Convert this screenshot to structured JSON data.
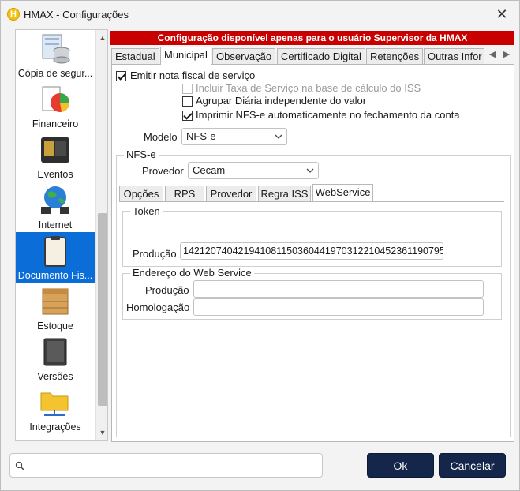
{
  "window": {
    "title": "HMAX - Configurações",
    "app_icon_letter": "H"
  },
  "sidebar": {
    "items": [
      {
        "label": "Cópia de segur...",
        "icon": "database-backup-icon"
      },
      {
        "label": "Financeiro",
        "icon": "finance-pie-icon"
      },
      {
        "label": "Eventos",
        "icon": "wallet-icon"
      },
      {
        "label": "Internet",
        "icon": "globe-network-icon"
      },
      {
        "label": "Documento Fis...",
        "icon": "clipboard-icon",
        "selected": true
      },
      {
        "label": "Estoque",
        "icon": "crate-icon"
      },
      {
        "label": "Versões",
        "icon": "tablet-icon"
      },
      {
        "label": "Integrações",
        "icon": "folder-network-icon"
      }
    ]
  },
  "banner": {
    "text": "Configuração disponível apenas para o usuário Supervisor da HMAX"
  },
  "tabs": [
    "Estadual",
    "Municipal",
    "Observação",
    "Certificado Digital",
    "Retenções",
    "Outras Infor"
  ],
  "active_tab": "Municipal",
  "municipal": {
    "emitir_label": "Emitir nota fiscal de serviço",
    "incluir_taxa_label": "Incluir Taxa de Serviço na base de cálculo do ISS",
    "agrupar_label": "Agrupar Diária independente do valor",
    "imprimir_label": "Imprimir NFS-e automaticamente no fechamento da conta",
    "modelo_label": "Modelo",
    "modelo_value": "NFS-e",
    "nfse_group_title": "NFS-e",
    "provedor_label": "Provedor",
    "provedor_value": "Cecam",
    "subtabs": [
      "Opções",
      "RPS",
      "Provedor",
      "Regra ISS",
      "WebService"
    ],
    "active_subtab": "WebService",
    "token_group_title": "Token",
    "token_producao_label": "Produção",
    "token_producao_value": "142120740421941081150360441970312210452361190795",
    "endereco_group_title": "Endereço do Web Service",
    "endereco_producao_label": "Produção",
    "endereco_producao_value": "",
    "endereco_homologacao_label": "Homologação",
    "endereco_homologacao_value": ""
  },
  "footer": {
    "search_value": "",
    "ok_label": "Ok",
    "cancel_label": "Cancelar"
  },
  "colors": {
    "banner": "#c80000",
    "selection": "#0a6dd8",
    "button": "#14264a"
  }
}
